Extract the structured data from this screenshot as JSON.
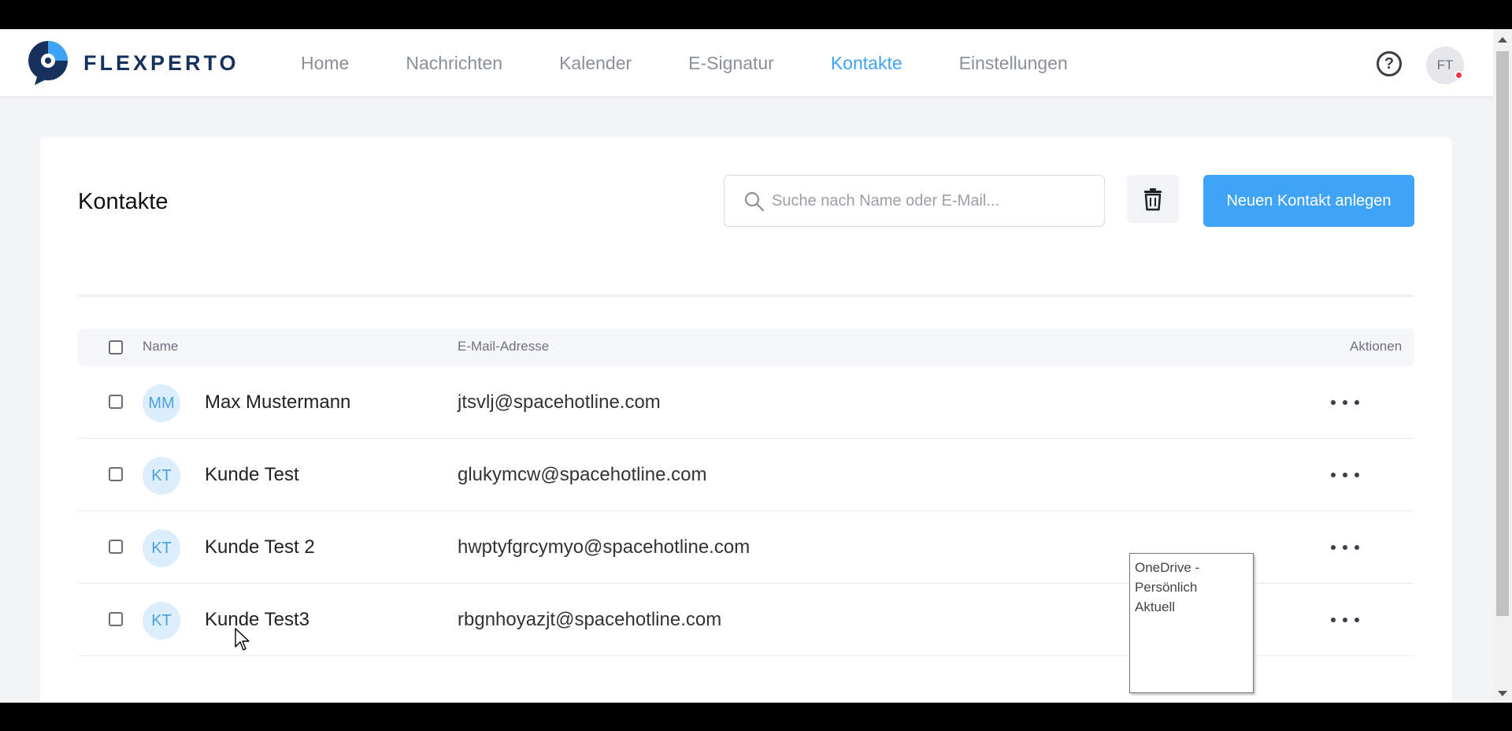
{
  "app": {
    "brand": "FLEXPERTO"
  },
  "nav": {
    "items": [
      {
        "label": "Home",
        "active": false
      },
      {
        "label": "Nachrichten",
        "active": false
      },
      {
        "label": "Kalender",
        "active": false
      },
      {
        "label": "E-Signatur",
        "active": false
      },
      {
        "label": "Kontakte",
        "active": true
      },
      {
        "label": "Einstellungen",
        "active": false
      }
    ],
    "user_initials": "FT"
  },
  "page": {
    "title": "Kontakte",
    "search_placeholder": "Suche nach Name oder E-Mail...",
    "new_contact_label": "Neuen Kontakt anlegen"
  },
  "table": {
    "headers": {
      "name": "Name",
      "email": "E-Mail-Adresse",
      "actions": "Aktionen"
    },
    "rows": [
      {
        "initials": "MM",
        "name": "Max Mustermann",
        "email": "jtsvlj@spacehotline.com"
      },
      {
        "initials": "KT",
        "name": "Kunde Test",
        "email": "glukymcw@spacehotline.com"
      },
      {
        "initials": "KT",
        "name": "Kunde Test 2",
        "email": "hwptyfgrcymyo@spacehotline.com"
      },
      {
        "initials": "KT",
        "name": "Kunde Test3",
        "email": "rbgnhoyazjt@spacehotline.com"
      }
    ]
  },
  "tooltip": {
    "line1": "OneDrive -",
    "line2": "Persönlich",
    "line3": "Aktuell"
  },
  "colors": {
    "accent": "#3ea2f5",
    "brand_dark": "#16325c",
    "notification": "#f0364a"
  },
  "icons": {
    "help": "question-circle-icon",
    "search": "magnifier-icon",
    "delete": "trash-icon",
    "row_actions": "more-horizontal-icon"
  }
}
